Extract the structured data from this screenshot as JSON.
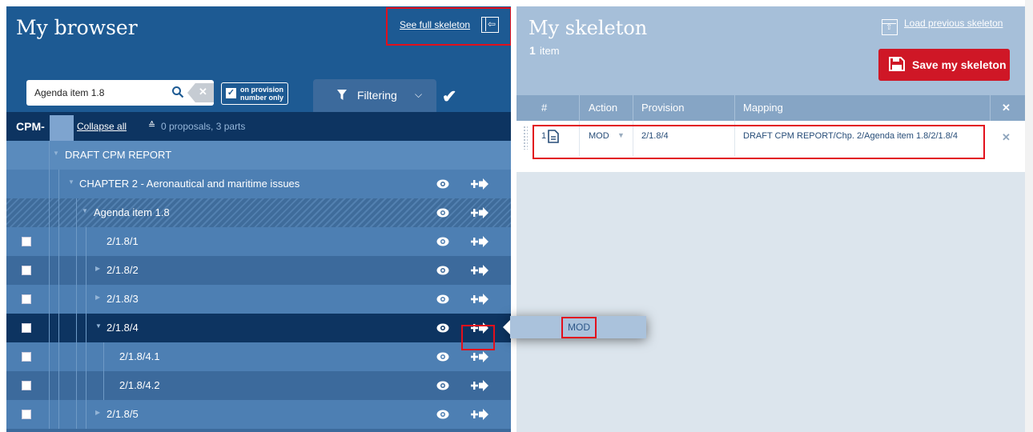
{
  "browser": {
    "title": "My browser",
    "see_full_skeleton": "See full skeleton",
    "search": {
      "value": "Agenda item 1.8",
      "placeholder": ""
    },
    "provision_only": "on provision number only",
    "filtering": "Filtering",
    "cpm": {
      "prefix": "CPM-",
      "collapse_all": "Collapse all",
      "stats": "0 proposals, 3 parts"
    },
    "tree": [
      {
        "label": "DRAFT CPM REPORT"
      },
      {
        "label": "CHAPTER 2 - Aeronautical and maritime issues"
      },
      {
        "label": "Agenda item 1.8"
      },
      {
        "label": "2/1.8/1"
      },
      {
        "label": "2/1.8/2"
      },
      {
        "label": "2/1.8/3"
      },
      {
        "label": "2/1.8/4"
      },
      {
        "label": "2/1.8/4.1"
      },
      {
        "label": "2/1.8/4.2"
      },
      {
        "label": "2/1.8/5"
      }
    ],
    "popup_action": "MOD"
  },
  "skeleton": {
    "title": "My skeleton",
    "count": "1",
    "count_label": "item",
    "load_previous": "Load previous skeleton",
    "save": "Save my skeleton",
    "columns": {
      "num": "#",
      "action": "Action",
      "provision": "Provision",
      "mapping": "Mapping",
      "remove": "✕"
    },
    "rows": [
      {
        "num": "1",
        "action": "MOD",
        "provision": "2/1.8/4",
        "mapping": "DRAFT CPM REPORT/Chp. 2/Agenda item 1.8/2/1.8/4",
        "remove": "✕"
      }
    ]
  },
  "colors": {
    "header": "#1d5a93",
    "row": "#3c6a9c",
    "selected": "#0d3461",
    "save": "#cf1726",
    "highlight": "#e2101c"
  },
  "icons": [
    "search-icon",
    "clear-icon",
    "filter-icon",
    "chevron-down-icon",
    "check-icon",
    "collapse-icon",
    "eye-icon",
    "add-to-skeleton-icon",
    "document-icon",
    "save-icon",
    "load-icon",
    "expand-panel-icon",
    "close-icon"
  ]
}
